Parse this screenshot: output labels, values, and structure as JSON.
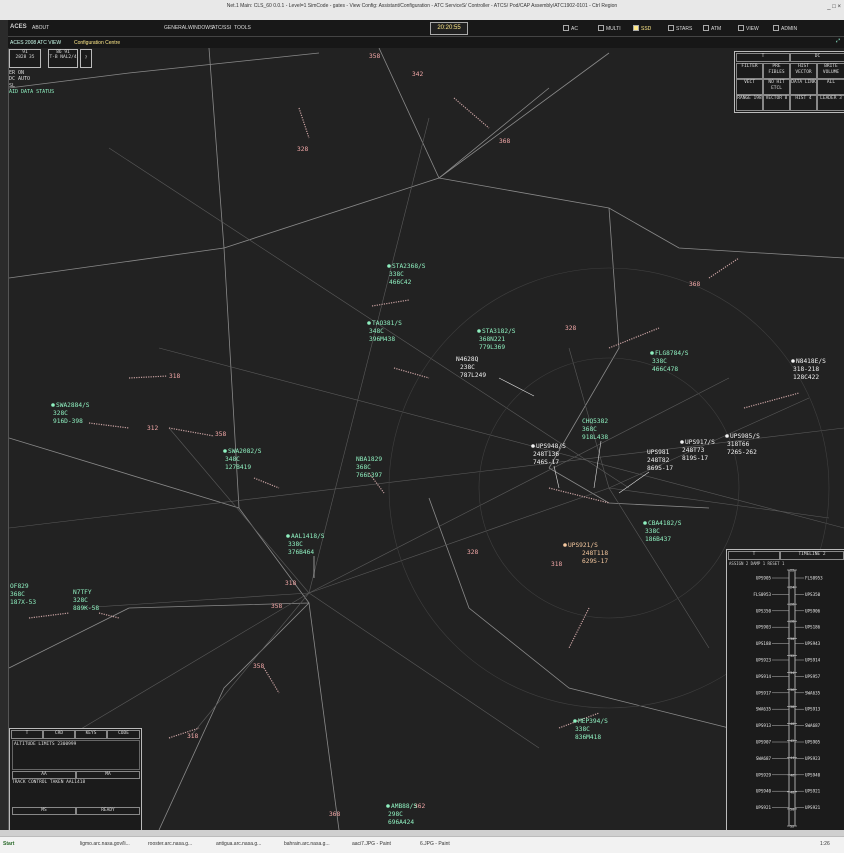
{
  "window": {
    "title": "Net.1 Main: CLS_60 0.0.1 - Level=1 SimCode - gates - View Config: Assistant/Configuration - ATC ServiceS/ Controller - ATCS/ Pod/CAP Assembly/ATC1902-0101 - Ctrl Region"
  },
  "menubar": {
    "logo": "ACES",
    "about": "ABOUT",
    "menus": [
      "GENERAL",
      "WINDOWS",
      "ATC/SSI",
      "TOOLS"
    ],
    "clock": "20:20:55",
    "toggles": [
      {
        "label": "AC",
        "on": false
      },
      {
        "label": "MULTI",
        "on": false
      },
      {
        "label": "SSD",
        "on": true
      },
      {
        "label": "STARS",
        "on": false
      },
      {
        "label": "ATM",
        "on": false
      },
      {
        "label": "VIEW",
        "on": false
      },
      {
        "label": "ADMIN",
        "on": false
      }
    ]
  },
  "subbar": {
    "view": "ACES 2008 ATC VIEW",
    "config": "Configuration Centre"
  },
  "topleft": {
    "box1_line1": "91",
    "box1_line2": "2828  35",
    "box2_line1": "86  91",
    "box2_line2": "T-B  NAL2/4",
    "box3": "?",
    "status1": "ER ON",
    "status2": "DC AUTO",
    "status3": "SL",
    "status4": "AID DATA STATUS"
  },
  "rightpanel": {
    "row0": [
      "T",
      "DC"
    ],
    "row1": [
      "FILTER",
      "PRE FIBLES",
      "HIST VECTOR",
      "BRITE VOLUME"
    ],
    "row2": [
      "VECT",
      "NO HIT ETCL",
      "DATA LINK",
      "ALL"
    ],
    "row3": [
      "RANGE 198",
      "VECTOR 8",
      "HIST 4",
      "LEADER 3"
    ]
  },
  "timeline": {
    "tab_t": "T",
    "title": "TIMELINE 2",
    "subheader": "ASSIGN 2   DAMP 1   RESET 1",
    "left": [
      "UPS905",
      "FLS0953",
      "UPS350",
      "UPS903",
      "UPS188",
      "UPS923",
      "UPS914",
      "UPS917",
      "SWA635",
      "UPS913",
      "UPS907",
      "SWA687",
      "UPS929",
      "UPS940",
      "UPS921"
    ],
    "right": [
      "FLS0953",
      "UPS350",
      "UPS906",
      "UPS186",
      "UPS943",
      "UPS914",
      "UPS957",
      "SWA635",
      "UPS913",
      "SWA687",
      "UPS905",
      "UPS923",
      "UPS940",
      "UPS921",
      "UPS921"
    ],
    "ticks": [
      "22",
      "24",
      "26",
      "28",
      "30",
      "32",
      "34",
      "36",
      "38",
      "40",
      "42",
      "44",
      "46",
      "48",
      "50",
      "52"
    ]
  },
  "leftpanel": {
    "tabs": [
      "T",
      "CRD",
      "KEYS",
      "CODE"
    ],
    "line1": "ALTITUDE LIMITS 2300999",
    "mid_left": "AA",
    "mid_right": "MA",
    "line2": "TRACK CONTROL TAKEN AAL1418",
    "bot_left": "MS",
    "bot_right": "READY"
  },
  "flights": [
    {
      "callsign": "STA2368/S",
      "l2": "338C",
      "l3": "466C42"
    },
    {
      "callsign": "TAO381/S",
      "l2": "348C",
      "l3": "396M438"
    },
    {
      "callsign": "STA3182/S",
      "l2": "368N221",
      "l3": "779L369"
    },
    {
      "callsign": "N4628Q",
      "l2": "238C",
      "l3": "787L249"
    },
    {
      "callsign": "FLG8784/S",
      "l2": "338C",
      "l3": "466C478"
    },
    {
      "callsign": "N8418E/S",
      "l2": "318-218",
      "l3": "128C422"
    },
    {
      "callsign": "SWA2884/S",
      "l2": "328C",
      "l3": "916D-398"
    },
    {
      "callsign": "SWA2082/S",
      "l2": "348C",
      "l3": "127B419"
    },
    {
      "callsign": "NBA1829",
      "l2": "368C",
      "l3": "766L397"
    },
    {
      "callsign": "CHQ5382",
      "l2": "368C",
      "l3": "918L438"
    },
    {
      "callsign": "UPS948/S",
      "l2": "248T136",
      "l3": "746S-17"
    },
    {
      "callsign": "UPS917/S",
      "l2": "248T73",
      "l3": "819S-17"
    },
    {
      "callsign": "UPS985/S",
      "l2": "318T66",
      "l3": "726S-262"
    },
    {
      "callsign": "UPS981",
      "l2": "248T82",
      "l3": "869S-17"
    },
    {
      "callsign": "CBA4182/S",
      "l2": "338C",
      "l3": "186B437"
    },
    {
      "callsign": "AAL1418/S",
      "l2": "338C",
      "l3": "376B464"
    },
    {
      "callsign": "UPS921/S",
      "l2": "248T118",
      "l3": "629S-17"
    },
    {
      "callsign": "N7TFY",
      "l2": "328C",
      "l3": "889K-58"
    },
    {
      "callsign": "OF829",
      "l2": "368C",
      "l3": "187X-53"
    },
    {
      "callsign": "MEP394/S",
      "l2": "338C",
      "l3": "836M418"
    },
    {
      "callsign": "AMB88/S",
      "l2": "298C",
      "l3": "696A424"
    }
  ],
  "fixes": [
    "358",
    "342",
    "328",
    "368",
    "368",
    "318",
    "328",
    "312",
    "358",
    "328",
    "318",
    "358",
    "318",
    "358",
    "318",
    "362",
    "368"
  ],
  "taskbar": {
    "start": "Start",
    "items": [
      "ligmo.arc.nasa.gov/li...",
      "rooster.arc.nasa.g...",
      "antigua.arc.nasa.g...",
      "bahrain.arc.nasa.g...",
      "aaci7.JPG - Paint",
      "6.JPG - Paint"
    ],
    "time": "1:26"
  }
}
